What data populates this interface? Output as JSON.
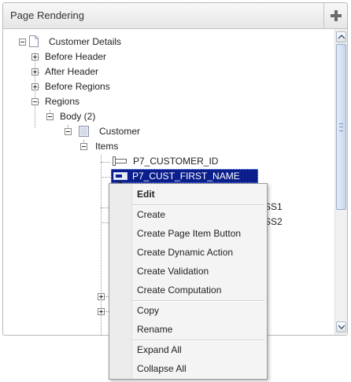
{
  "panel": {
    "title": "Page Rendering",
    "add_icon": "plus-icon"
  },
  "tree": {
    "root": "Customer Details",
    "before_header": "Before Header",
    "after_header": "After Header",
    "before_regions": "Before Regions",
    "regions": "Regions",
    "body": "Body (2)",
    "customer": "Customer",
    "items": "Items",
    "item1": "P7_CUSTOMER_ID",
    "item2": "P7_CUST_FIRST_NAME",
    "partial1": "SS1",
    "partial2": "SS2"
  },
  "context_menu": {
    "edit": "Edit",
    "create": "Create",
    "create_page_item_button": "Create Page Item Button",
    "create_dynamic_action": "Create Dynamic Action",
    "create_validation": "Create Validation",
    "create_computation": "Create Computation",
    "copy": "Copy",
    "rename": "Rename",
    "expand_all": "Expand All",
    "collapse_all": "Collapse All"
  },
  "colors": {
    "selection": "#0b1e8c",
    "panel_border": "#b9b9b9"
  },
  "icons": {
    "page": "page-icon",
    "region": "region-icon",
    "item": "page-item-icon",
    "cursor": "hand-cursor-icon"
  }
}
